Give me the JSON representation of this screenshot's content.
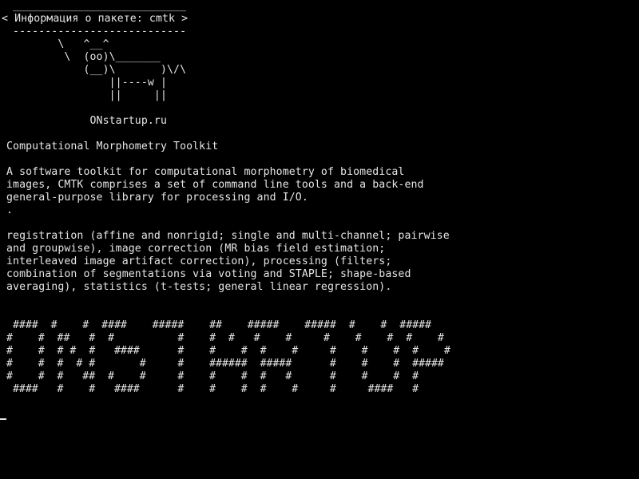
{
  "terminal": {
    "bubble_top": " ___________________________",
    "bubble_text": "< Информация о пакете: cmtk >",
    "bubble_bottom": " ---------------------------",
    "cow": [
      "        \\   ^__^",
      "         \\  (oo)\\_______",
      "            (__)\\       )\\/\\",
      "                ||----w |",
      "                ||     ||"
    ],
    "site": "             ONstartup.ru",
    "package_title": "Computational Morphometry Toolkit",
    "description": [
      "A software toolkit for computational morphometry of biomedical",
      "images, CMTK comprises a set of command line tools and a back-end",
      "general-purpose library for processing and I/O.",
      "."
    ],
    "features": [
      "registration (affine and nonrigid; single and multi-channel; pairwise",
      "and groupwise), image correction (MR bias field estimation;",
      "interleaved image artifact correction), processing (filters;",
      "combination of segmentations via voting and STAPLE; shape-based",
      "averaging), statistics (t-tests; general linear regression)."
    ],
    "banner": " ####  #    #  ####    #####    ##    #####    #####  #    #  #####\n#    #  ##   #  #          #    #  #   #    #     #    #    #  #    #\n#    #  # #  #   ####      #    #    #  #    #     #    #    #  #    #\n#    #  #  # #       #     #    ######  #####      #    #    #  #####\n#    #  #   ##  #    #     #    #    #  #   #      #    #    #  #\n ####   #    #   ####      #    #    #  #    #     #     ####   #"
  }
}
